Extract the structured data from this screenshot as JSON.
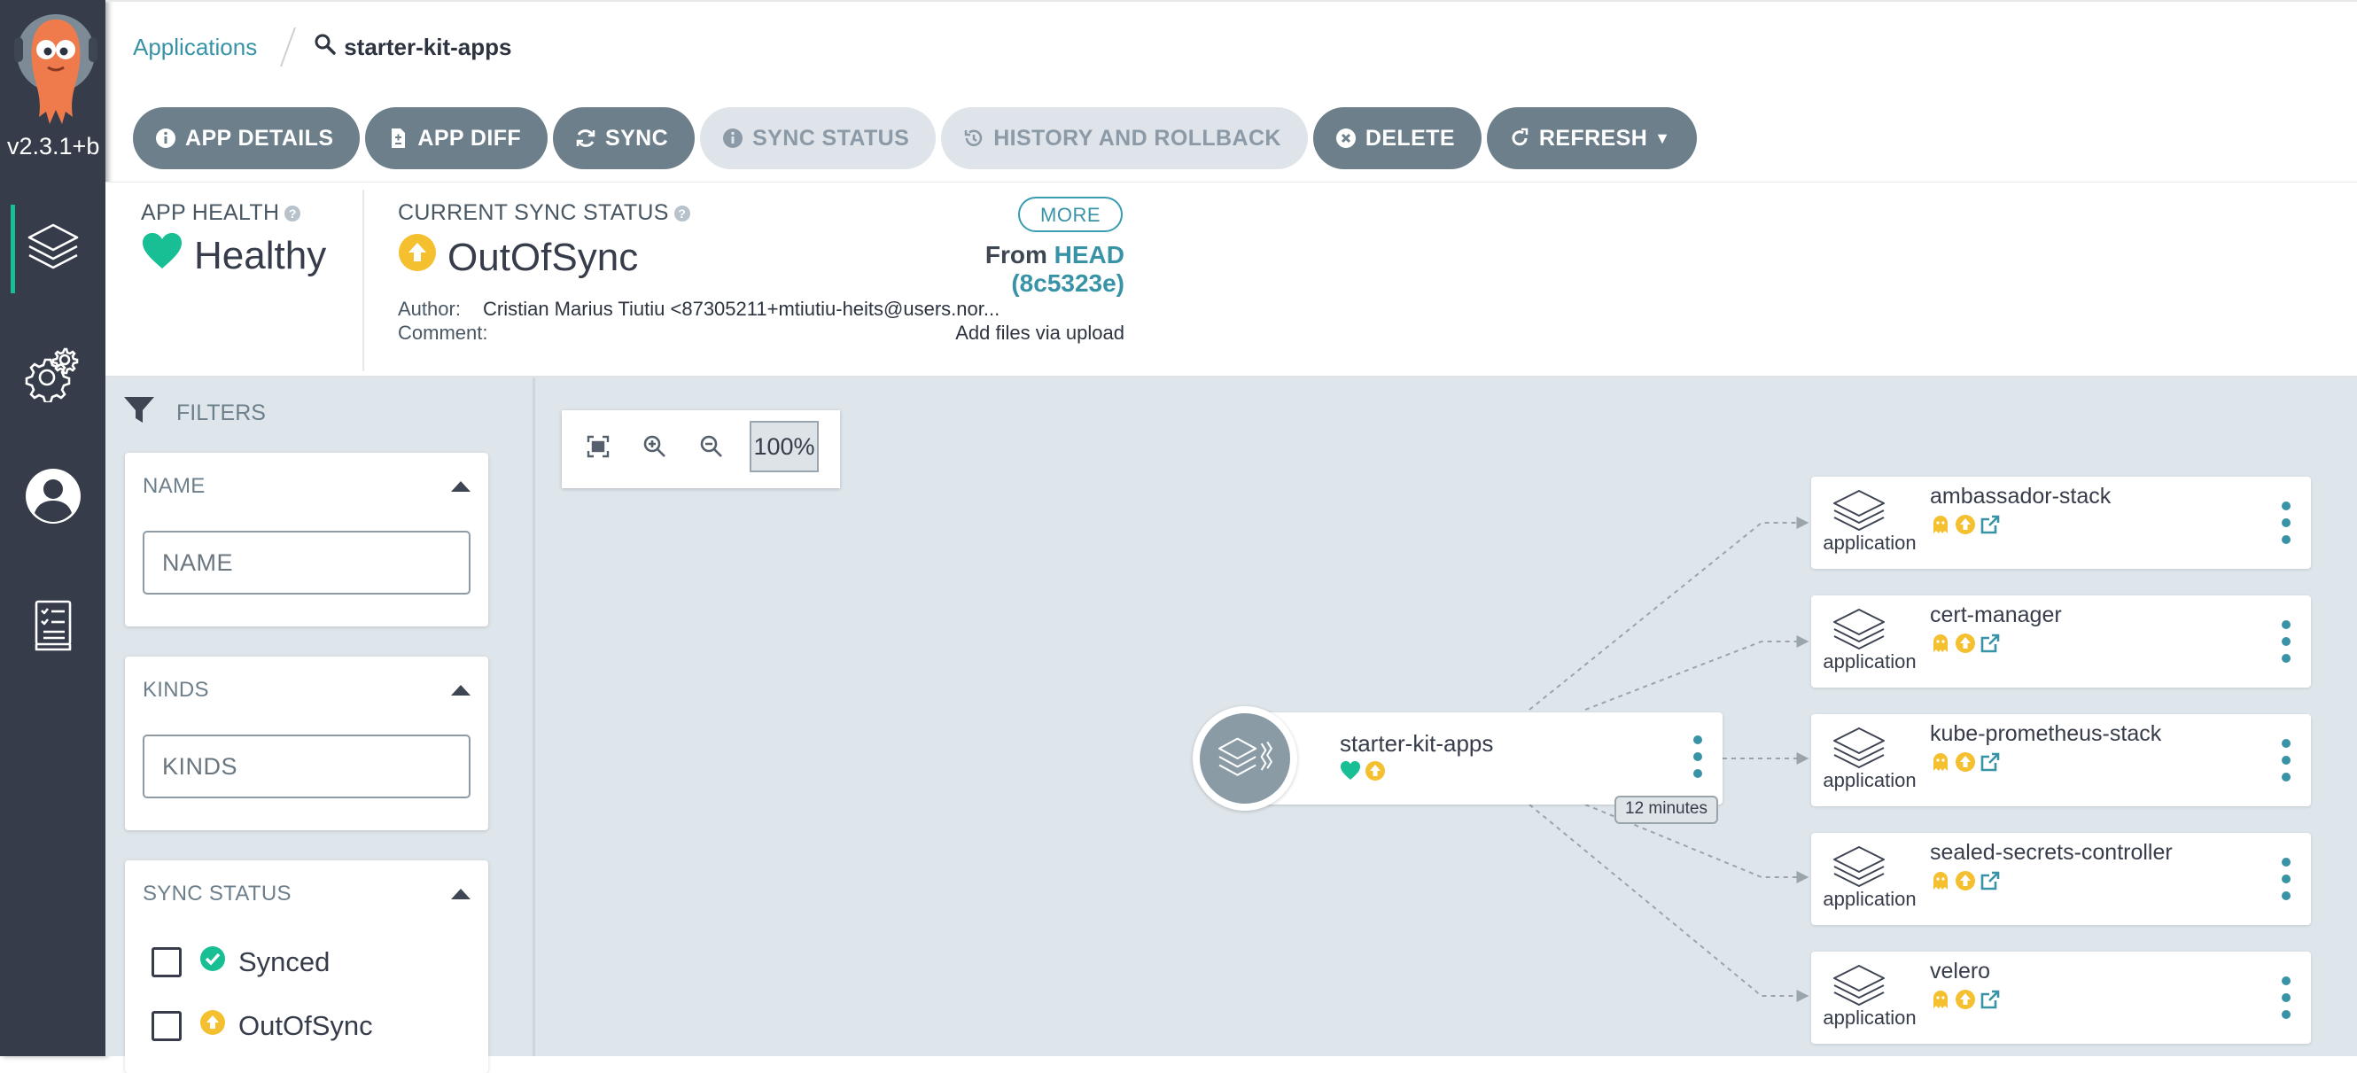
{
  "nav": {
    "version": "v2.3.1+b",
    "items": [
      {
        "icon": "layers-icon"
      },
      {
        "icon": "gear-icon"
      },
      {
        "icon": "user-icon"
      },
      {
        "icon": "docs-icon"
      }
    ]
  },
  "breadcrumb": {
    "root": "Applications",
    "current": "starter-kit-apps"
  },
  "toolbar": {
    "app_details": "APP DETAILS",
    "app_diff": "APP DIFF",
    "sync": "SYNC",
    "sync_status": "SYNC STATUS",
    "history": "HISTORY AND ROLLBACK",
    "delete": "DELETE",
    "refresh": "REFRESH"
  },
  "status": {
    "health_label": "APP HEALTH",
    "health_value": "Healthy",
    "sync_label": "CURRENT SYNC STATUS",
    "sync_value": "OutOfSync",
    "more": "MORE",
    "from_label": "From",
    "from_ref": "HEAD (8c5323e)",
    "author_label": "Author:",
    "author_value": "Cristian Marius Tiutiu <87305211+mtiutiu-heits@users.nor...",
    "comment_label": "Comment:",
    "comment_value": "Add files via upload",
    "colors": {
      "healthy": "#18be94",
      "out_of_sync": "#f4c030"
    }
  },
  "filters": {
    "title": "FILTERS",
    "name": {
      "title": "NAME",
      "placeholder": "NAME"
    },
    "kinds": {
      "title": "KINDS",
      "placeholder": "KINDS"
    },
    "sync_status": {
      "title": "SYNC STATUS",
      "options": [
        {
          "label": "Synced",
          "icon": "check-circle-icon"
        },
        {
          "label": "OutOfSync",
          "icon": "arrow-up-circle-icon"
        }
      ]
    }
  },
  "graph": {
    "zoom_level": "100%",
    "root": {
      "name": "starter-kit-apps",
      "age": "12 minutes"
    },
    "children": [
      {
        "name": "ambassador-stack",
        "kind": "application"
      },
      {
        "name": "cert-manager",
        "kind": "application"
      },
      {
        "name": "kube-prometheus-stack",
        "kind": "application"
      },
      {
        "name": "sealed-secrets-controller",
        "kind": "application"
      },
      {
        "name": "velero",
        "kind": "application"
      }
    ]
  }
}
